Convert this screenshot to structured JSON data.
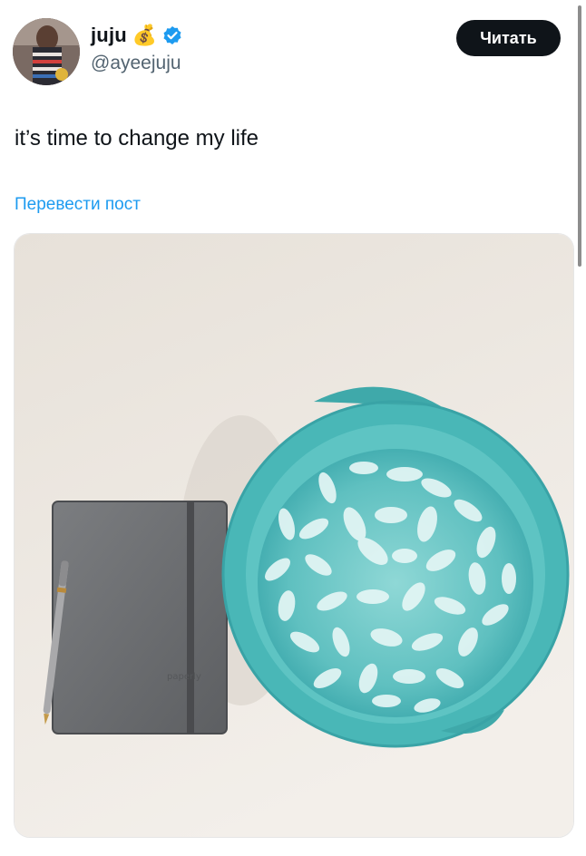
{
  "tweet": {
    "author": {
      "name": "juju",
      "emoji": "💰",
      "handle": "@ayeejuju",
      "verified": true
    },
    "follow_button_label": "Читать",
    "text": "it’s time to change my life",
    "translate_label": "Перевести пост",
    "media": {
      "description_icon": "photo",
      "notebook_brand": "paperly"
    }
  },
  "colors": {
    "link_blue": "#1d9bf0",
    "text_primary": "#0f1419",
    "text_secondary": "#536471",
    "verified_blue": "#1d9bf0"
  }
}
